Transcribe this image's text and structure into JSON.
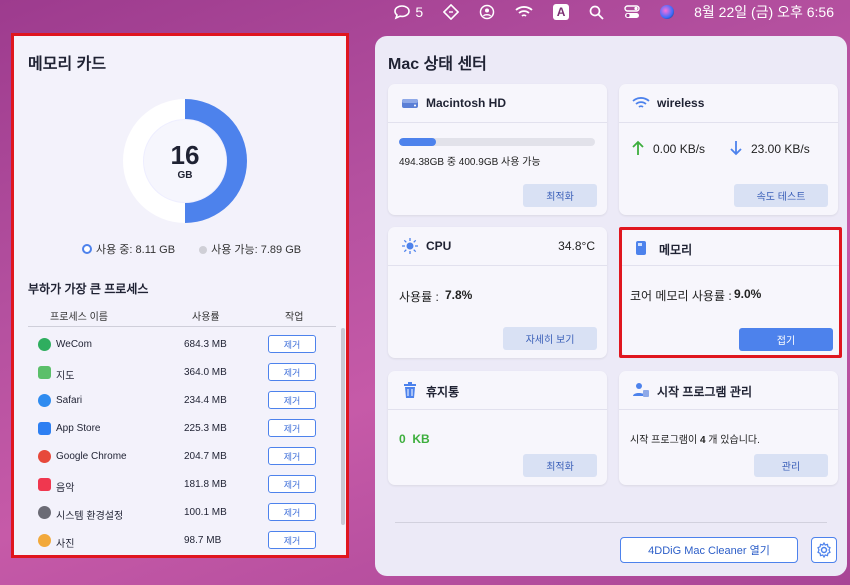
{
  "menubar": {
    "wecom_count": "5",
    "input_mode": "A",
    "datetime": "8월 22일 (금) 오후 6:56"
  },
  "memory_card": {
    "title": "메모리 카드",
    "total": "16",
    "unit": "GB",
    "used_fraction": 0.5,
    "legend_used": "사용 중: 8.11 GB",
    "legend_free": "사용 가능: 7.89 GB",
    "process_title": "부하가 가장 큰 프로세스",
    "columns": {
      "name": "프로세스 이름",
      "usage": "사용률",
      "action": "작업"
    },
    "remove_label": "제거",
    "processes": [
      {
        "name": "WeCom",
        "usage": "684.3 MB",
        "icon": "wecom-icon",
        "color": "#2fae5f"
      },
      {
        "name": "지도",
        "usage": "364.0 MB",
        "icon": "maps-icon",
        "color": "#5bbf6a"
      },
      {
        "name": "Safari",
        "usage": "234.4 MB",
        "icon": "safari-icon",
        "color": "#2f8cf0"
      },
      {
        "name": "App Store",
        "usage": "225.3 MB",
        "icon": "app-store-icon",
        "color": "#2d7ff2"
      },
      {
        "name": "Google Chrome",
        "usage": "204.7 MB",
        "icon": "chrome-icon",
        "color": "#e7493b"
      },
      {
        "name": "음악",
        "usage": "181.8 MB",
        "icon": "music-icon",
        "color": "#f0374f"
      },
      {
        "name": "시스템 환경설정",
        "usage": "100.1 MB",
        "icon": "settings-icon",
        "color": "#6b6b75"
      },
      {
        "name": "사진",
        "usage": "98.7 MB",
        "icon": "photos-icon",
        "color": "#f2a93b"
      }
    ]
  },
  "status_center": {
    "title": "Mac 상태 센터",
    "disk": {
      "title": "Macintosh HD",
      "used_fraction": 0.19,
      "info": "494.38GB 중 400.9GB 사용 가능",
      "button": "최적화"
    },
    "wireless": {
      "title": "wireless",
      "up": "0.00 KB/s",
      "down": "23.00 KB/s",
      "button": "속도 테스트"
    },
    "cpu": {
      "title": "CPU",
      "temp": "34.8°C",
      "label": "사용률 :",
      "value": "7.8%",
      "button": "자세히 보기"
    },
    "memory": {
      "title": "메모리",
      "label": "코어 메모리 사용률 :",
      "value": "9.0%",
      "button": "접기"
    },
    "trash": {
      "title": "휴지통",
      "size": "0  KB",
      "button": "최적화"
    },
    "startup": {
      "title": "시작 프로그램 관리",
      "text_pre": "시작 프로그램이 ",
      "count": "4",
      "text_post": " 개 있습니다.",
      "button": "관리"
    },
    "open_button": "4DDiG Mac Cleaner 열기"
  },
  "colors": {
    "accent": "#4d82ec",
    "highlight": "#e0161f",
    "green": "#3dae3d"
  }
}
